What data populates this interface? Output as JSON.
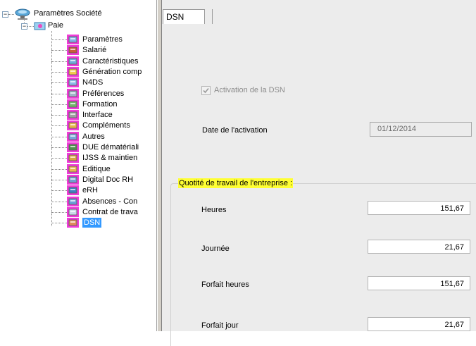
{
  "tree": {
    "root": {
      "label": "Paramètres Société",
      "expander": "−"
    },
    "child": {
      "label": "Paie",
      "expander": "−"
    },
    "items": [
      {
        "label": "Paramètres",
        "icon": "settings-icon"
      },
      {
        "label": "Salarié",
        "icon": "employee-icon"
      },
      {
        "label": "Caractéristiques",
        "icon": "characteristics-icon"
      },
      {
        "label": "Génération comp",
        "icon": "generation-icon"
      },
      {
        "label": "N4DS",
        "icon": "n4ds-icon"
      },
      {
        "label": "Préférences",
        "icon": "preferences-icon"
      },
      {
        "label": "Formation",
        "icon": "training-icon"
      },
      {
        "label": "Interface",
        "icon": "interface-icon"
      },
      {
        "label": "Compléments",
        "icon": "complements-icon"
      },
      {
        "label": "Autres",
        "icon": "others-icon"
      },
      {
        "label": "DUE dématériali",
        "icon": "due-icon"
      },
      {
        "label": "IJSS & maintien",
        "icon": "ijss-icon"
      },
      {
        "label": "Editique",
        "icon": "editique-icon"
      },
      {
        "label": "Digital Doc RH",
        "icon": "digital-doc-icon"
      },
      {
        "label": "eRH",
        "icon": "erh-icon"
      },
      {
        "label": "Absences - Con",
        "icon": "absences-icon"
      },
      {
        "label": "Contrat de trava",
        "icon": "contract-icon"
      },
      {
        "label": "DSN",
        "icon": "dsn-icon",
        "selected": true
      }
    ]
  },
  "tabs": [
    {
      "label": "DSN",
      "active": true
    }
  ],
  "form": {
    "activation_label": "Activation de la DSN",
    "activation_checked": true,
    "activation_enabled": false,
    "date_label": "Date de l'activation",
    "date_value": "01/12/2014",
    "group_title": "Quotité de travail de l'entreprise :",
    "rows": [
      {
        "label": "Heures",
        "value": "151,67"
      },
      {
        "label": "Journée",
        "value": "21,67"
      },
      {
        "label": "Forfait heures",
        "value": "151,67"
      },
      {
        "label": "Forfait jour",
        "value": "21,67"
      }
    ]
  },
  "colors": {
    "selection": "#3399ff",
    "icon_highlight": "#f03cd8",
    "group_title_highlight": "#ffff33"
  }
}
